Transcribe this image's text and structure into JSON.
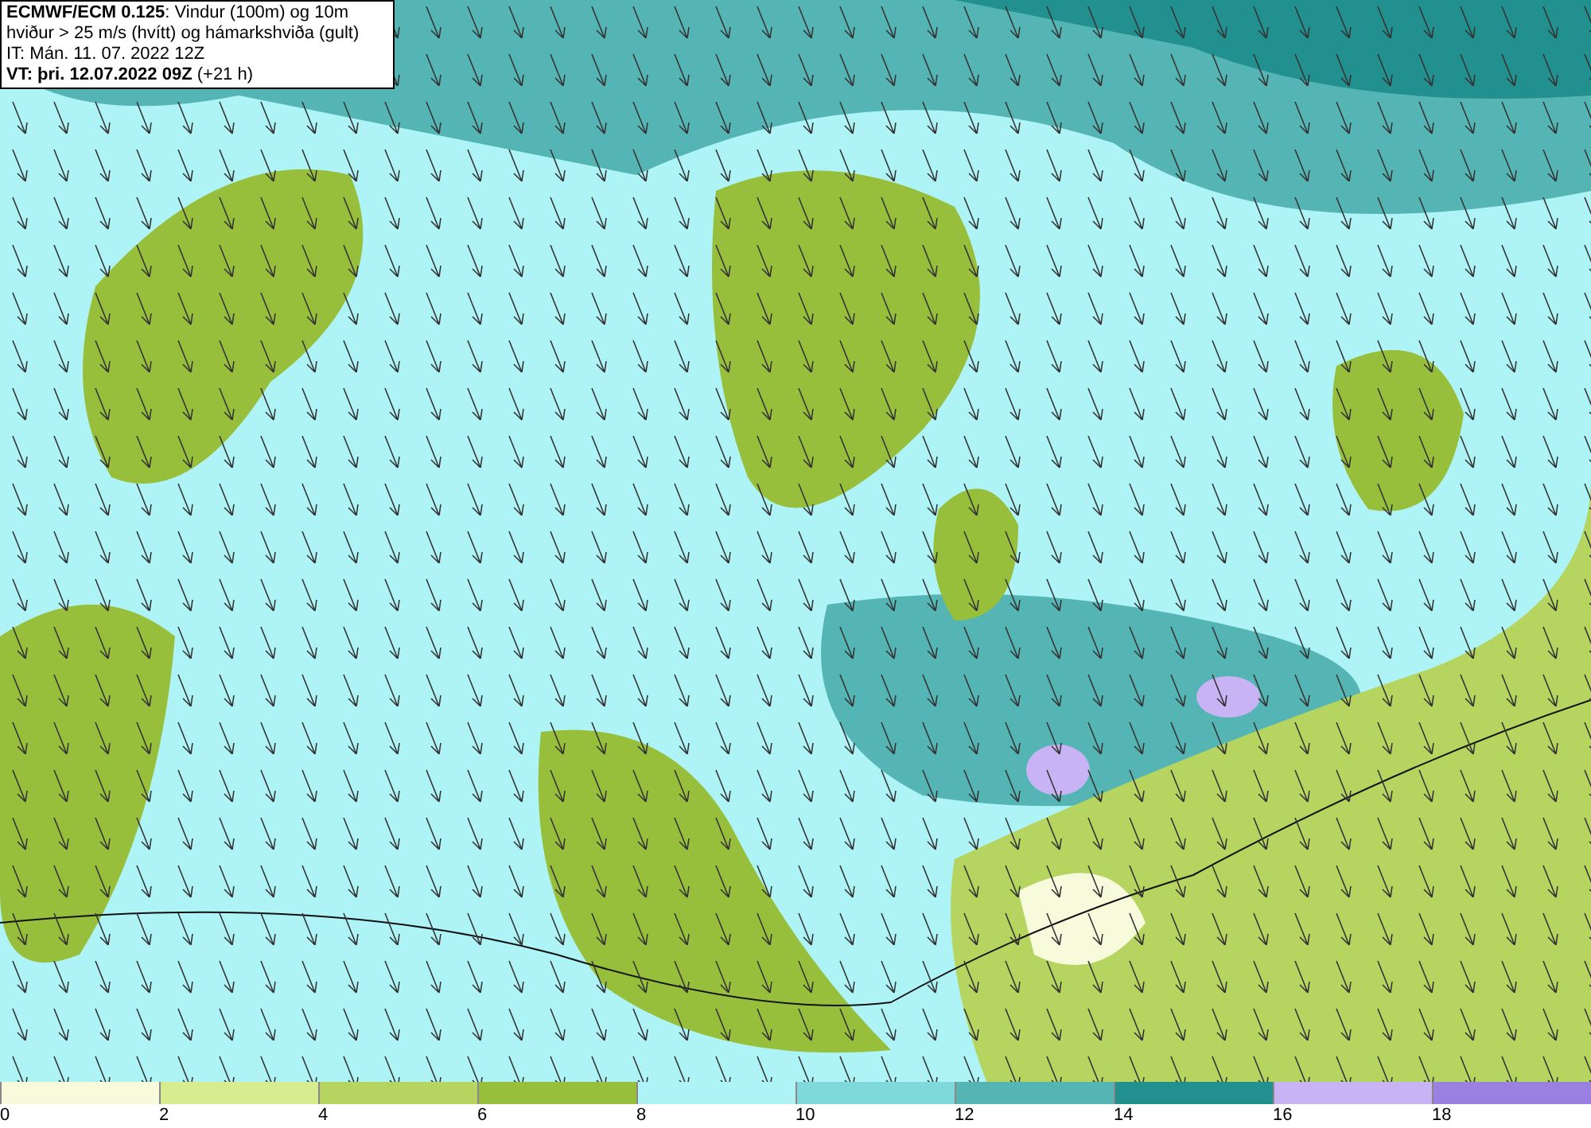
{
  "header": {
    "lines": [
      "**ECMWF/ECM 0.125**: Vindur (100m) og 10m",
      "hviður > 25 m/s (hvítt) og hámarkshviða (gult)",
      "IT: Mán. 11. 07. 2022 12Z",
      "**VT: þri. 12.07.2022 09Z** (+21 h)"
    ]
  },
  "legend": [
    {
      "label": "0",
      "color": "#f7fbdc"
    },
    {
      "label": "2",
      "color": "#d6ec8e"
    },
    {
      "label": "4",
      "color": "#b5d460"
    },
    {
      "label": "6",
      "color": "#98bf3c"
    },
    {
      "label": "8",
      "color": "#aef4f6"
    },
    {
      "label": "10",
      "color": "#7fd8da"
    },
    {
      "label": "12",
      "color": "#55b5b5"
    },
    {
      "label": "14",
      "color": "#22908e"
    },
    {
      "label": "16",
      "color": "#c8b3f5"
    },
    {
      "label": "18",
      "color": "#9a80e0"
    }
  ]
}
